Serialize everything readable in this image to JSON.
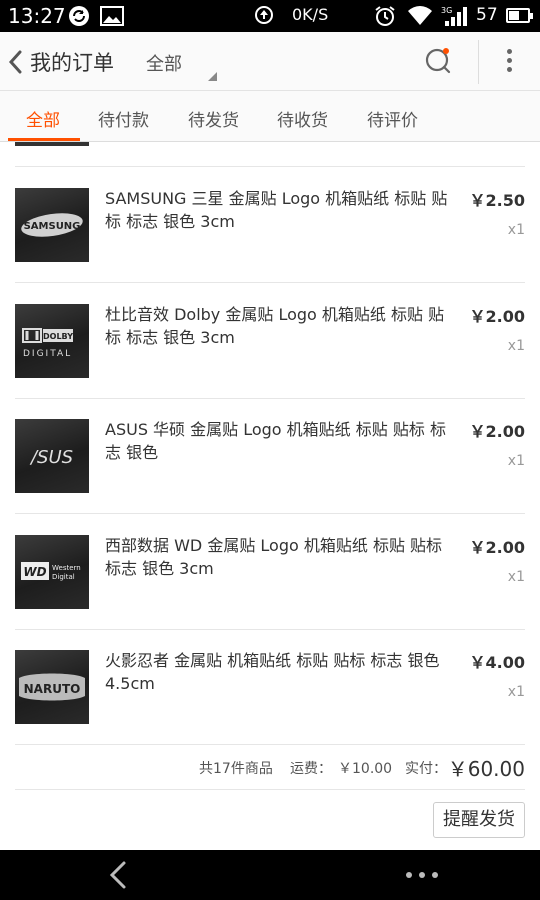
{
  "status_bar": {
    "time": "13:27",
    "network_speed": "0K/S",
    "network_type": "3G",
    "battery_level": "57",
    "battery_fraction": 0.57
  },
  "header": {
    "title": "我的订单",
    "filter_label": "全部"
  },
  "tabs": [
    {
      "label": "全部",
      "active": true
    },
    {
      "label": "待付款",
      "active": false
    },
    {
      "label": "待发货",
      "active": false
    },
    {
      "label": "待收货",
      "active": false
    },
    {
      "label": "待评价",
      "active": false
    }
  ],
  "items": [
    {
      "name": "SAMSUNG 三星 金属贴 Logo 机箱贴纸 标贴 贴标 标志 银色 3cm",
      "price": "￥2.50",
      "qty": "x1",
      "logo_text": "SAMSUNG"
    },
    {
      "name": "杜比音效 Dolby 金属贴 Logo 机箱贴纸 标贴 贴标 标志  银色 3cm",
      "price": "￥2.00",
      "qty": "x1",
      "logo_text": "DOLBY",
      "logo_sub": "DIGITAL"
    },
    {
      "name": "ASUS 华硕 金属贴 Logo 机箱贴纸 标贴 贴标 标志 银色",
      "price": "￥2.00",
      "qty": "x1",
      "logo_text": "/SUS"
    },
    {
      "name": "西部数据 WD 金属贴 Logo 机箱贴纸 标贴 贴标 标志 银色 3cm",
      "price": "￥2.00",
      "qty": "x1",
      "logo_text": "WD",
      "logo_sub": "Western",
      "logo_sub2": "Digital"
    },
    {
      "name": "火影忍者 金属贴 机箱贴纸 标贴 贴标 标志 银色 4.5cm",
      "price": "￥4.00",
      "qty": "x1",
      "logo_text": "NARUTO"
    }
  ],
  "summary": {
    "count_text": "共17件商品",
    "shipping_label": "运费：",
    "shipping_value": "￥10.00",
    "paid_label": "实付：",
    "paid_value": "￥60.00"
  },
  "actions": {
    "remind_label": "提醒发货"
  },
  "colors": {
    "accent": "#ff5000",
    "statusbar_bg": "#000000",
    "header_bg": "#fafafa"
  },
  "icons": {
    "back": "chevron-left-icon",
    "search": "search-icon",
    "more": "more-vertical-icon",
    "sync": "sync-icon",
    "image": "image-icon",
    "upload": "upload-icon",
    "alarm": "alarm-icon",
    "wifi": "wifi-icon",
    "signal": "signal-icon",
    "battery": "battery-icon"
  }
}
